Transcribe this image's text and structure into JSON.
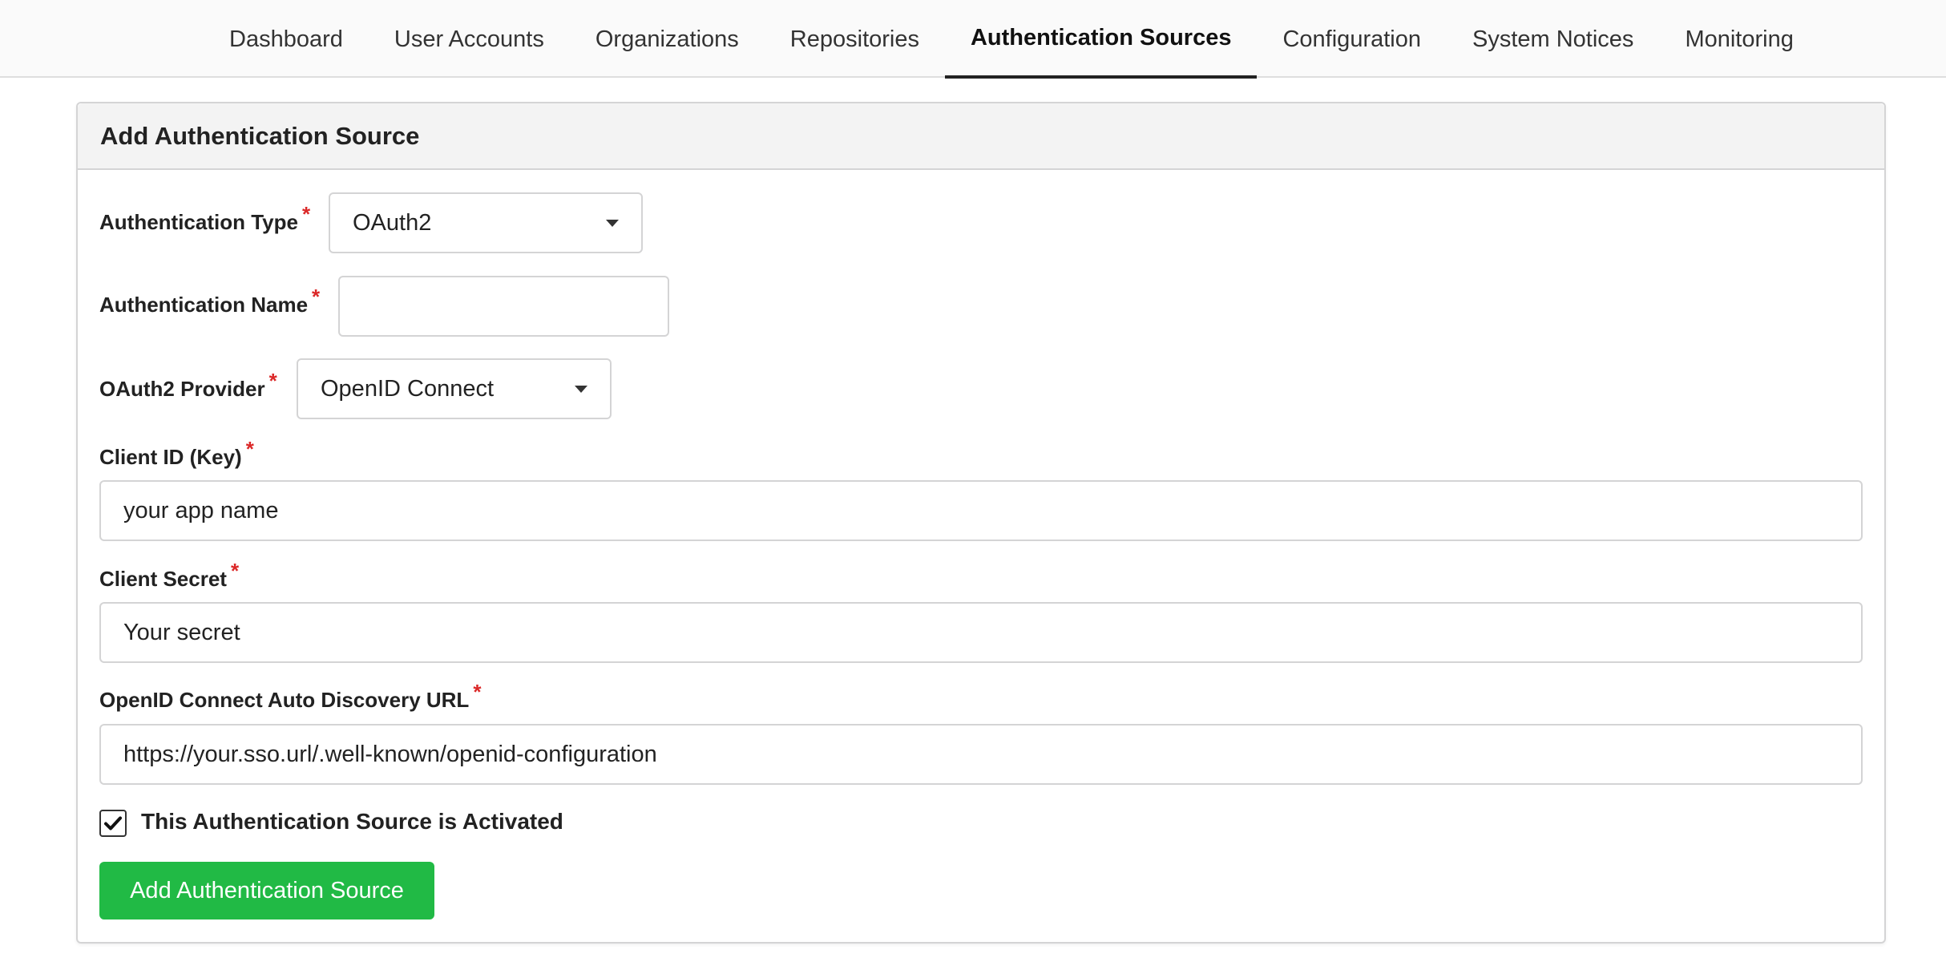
{
  "nav": {
    "tabs": [
      {
        "label": "Dashboard",
        "active": false
      },
      {
        "label": "User Accounts",
        "active": false
      },
      {
        "label": "Organizations",
        "active": false
      },
      {
        "label": "Repositories",
        "active": false
      },
      {
        "label": "Authentication Sources",
        "active": true
      },
      {
        "label": "Configuration",
        "active": false
      },
      {
        "label": "System Notices",
        "active": false
      },
      {
        "label": "Monitoring",
        "active": false
      }
    ]
  },
  "form": {
    "title": "Add Authentication Source",
    "required_marker": "*",
    "auth_type": {
      "label": "Authentication Type",
      "value": "OAuth2"
    },
    "auth_name": {
      "label": "Authentication Name",
      "value": ""
    },
    "provider": {
      "label": "OAuth2 Provider",
      "value": "OpenID Connect"
    },
    "client_id": {
      "label": "Client ID (Key)",
      "value": "your app name"
    },
    "client_secret": {
      "label": "Client Secret",
      "value": "Your secret"
    },
    "discovery_url": {
      "label": "OpenID Connect Auto Discovery URL",
      "value": "https://your.sso.url/.well-known/openid-configuration"
    },
    "activated": {
      "label": "This Authentication Source is Activated",
      "checked": true
    },
    "submit_label": "Add Authentication Source"
  },
  "colors": {
    "submit_button": "#21ba45",
    "required_marker": "#db2828",
    "active_tab_underline": "#222222"
  }
}
